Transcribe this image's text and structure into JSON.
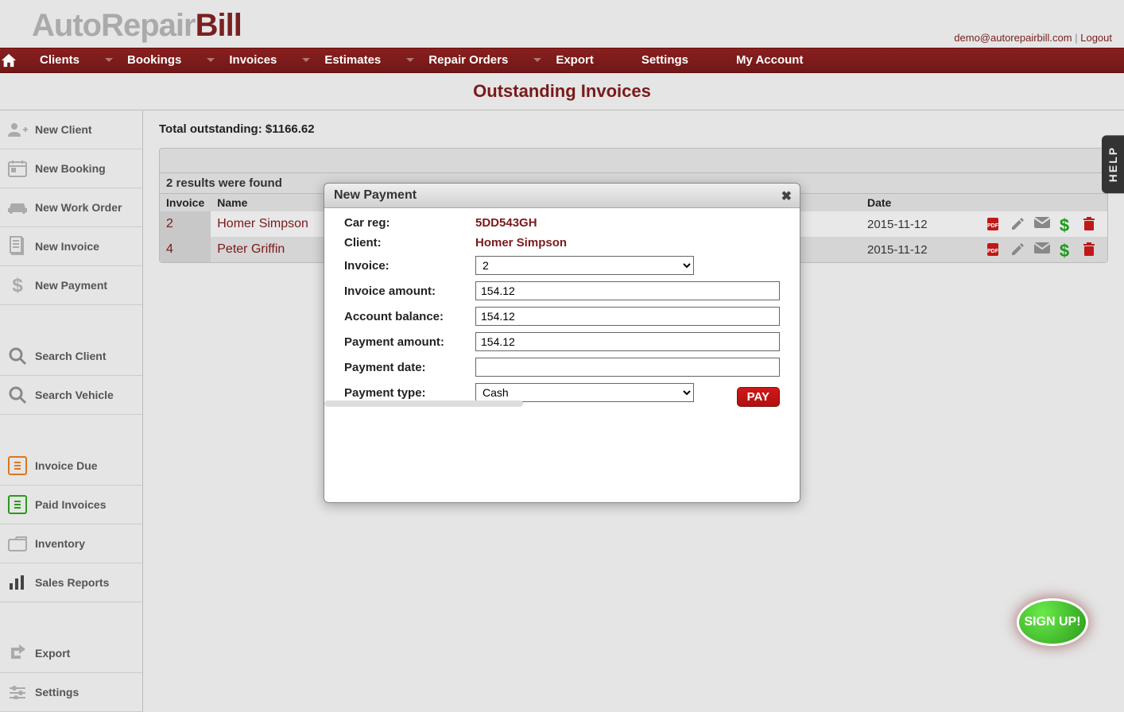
{
  "logo": {
    "part1": "AutoRepair",
    "part2": "Bill"
  },
  "user": {
    "email": "demo@autorepairbill.com",
    "logout": "Logout"
  },
  "nav": {
    "clients": "Clients",
    "bookings": "Bookings",
    "invoices": "Invoices",
    "estimates": "Estimates",
    "repair_orders": "Repair Orders",
    "export": "Export",
    "settings": "Settings",
    "my_account": "My Account"
  },
  "page_title": "Outstanding Invoices",
  "sidebar": {
    "new_client": "New Client",
    "new_booking": "New Booking",
    "new_work_order": "New Work Order",
    "new_invoice": "New Invoice",
    "new_payment": "New Payment",
    "search_client": "Search Client",
    "search_vehicle": "Search Vehicle",
    "invoice_due": "Invoice Due",
    "paid_invoices": "Paid Invoices",
    "inventory": "Inventory",
    "sales_reports": "Sales Reports",
    "export": "Export",
    "settings": "Settings"
  },
  "total_line": "Total outstanding: $1166.62",
  "results_found": "2 results were found",
  "table": {
    "headers": {
      "invoice": "Invoice",
      "name": "Name",
      "date": "Date"
    },
    "rows": [
      {
        "invoice": "2",
        "name": "Homer Simpson",
        "date": "2015-11-12"
      },
      {
        "invoice": "4",
        "name": "Peter Griffin",
        "date": "2015-11-12"
      }
    ]
  },
  "modal": {
    "title": "New Payment",
    "labels": {
      "car_reg": "Car reg:",
      "client": "Client:",
      "invoice": "Invoice:",
      "invoice_amount": "Invoice amount:",
      "account_balance": "Account balance:",
      "payment_amount": "Payment amount:",
      "payment_date": "Payment date:",
      "payment_type": "Payment type:"
    },
    "values": {
      "car_reg": "5DD543GH",
      "client": "Homer Simpson",
      "invoice": "2",
      "invoice_amount": "154.12",
      "account_balance": "154.12",
      "payment_amount": "154.12",
      "payment_date": "",
      "payment_type": "Cash"
    },
    "pay_button": "PAY"
  },
  "help_tab": "HELP",
  "signup": "SIGN UP!"
}
